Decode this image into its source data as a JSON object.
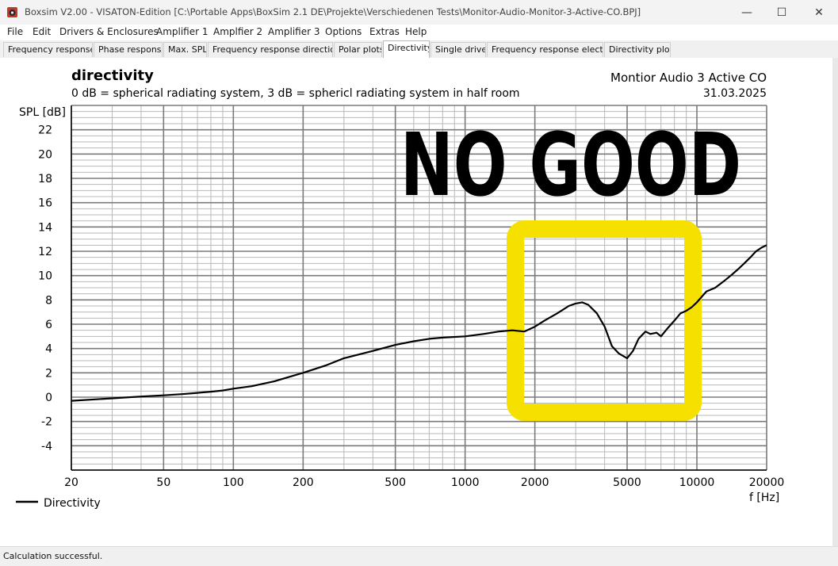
{
  "window": {
    "title": "Boxsim V2.00 - VISATON-Edition [C:\\Portable Apps\\BoxSim 2.1 DE\\Projekte\\Verschiedenen Tests\\Monitor-Audio-Monitor-3-Active-CO.BPJ]",
    "minimize_glyph": "—",
    "maximize_glyph": "☐",
    "close_glyph": "✕"
  },
  "menu": [
    "File",
    "Edit",
    "Drivers & Enclosures",
    "Amplifier 1",
    "Amplfier 2",
    "Amplifier 3",
    "Options",
    "Extras",
    "Help"
  ],
  "tabs": [
    {
      "label": "Frequency response.",
      "active": false
    },
    {
      "label": "Phase response",
      "active": false
    },
    {
      "label": "Max. SPL",
      "active": false
    },
    {
      "label": "Frequency response directions",
      "active": false
    },
    {
      "label": "Polar plots",
      "active": false
    },
    {
      "label": "Directivity",
      "active": true
    },
    {
      "label": "Single driver",
      "active": false
    },
    {
      "label": "Frequency response electr..",
      "active": false
    },
    {
      "label": "Directivity plots",
      "active": false
    }
  ],
  "status": "Calculation successful.",
  "colors": {
    "curve": "#000000",
    "highlight": "#f5e000",
    "grid_major": "#7a7a7a",
    "grid_minor": "#b8b8b8"
  },
  "chart_data": {
    "type": "line",
    "title": "directivity",
    "subtitle": "0 dB = spherical radiating system, 3 dB = sphericl radiating system in half room",
    "project": "Montior Audio 3 Active CO",
    "date": "31.03.2025",
    "ylabel": "SPL [dB]",
    "xlabel": "f [Hz]",
    "xscale": "log",
    "xlim": [
      20,
      20000
    ],
    "ylim": [
      -6,
      24
    ],
    "x_ticks": [
      20,
      50,
      100,
      200,
      500,
      1000,
      2000,
      5000,
      10000,
      20000
    ],
    "y_ticks": [
      -4,
      -2,
      0,
      2,
      4,
      6,
      8,
      10,
      12,
      14,
      16,
      18,
      20,
      22
    ],
    "legend_position": "bottom-left",
    "annotation_text": "NO GOOD",
    "series": [
      {
        "name": "Directivity",
        "x": [
          20,
          30,
          40,
          50,
          60,
          70,
          80,
          90,
          100,
          120,
          150,
          200,
          250,
          300,
          400,
          500,
          600,
          700,
          800,
          1000,
          1200,
          1400,
          1600,
          1800,
          2000,
          2200,
          2500,
          2800,
          3000,
          3200,
          3400,
          3700,
          4000,
          4300,
          4600,
          5000,
          5300,
          5600,
          6000,
          6300,
          6700,
          7000,
          7500,
          8000,
          8500,
          9000,
          9500,
          10000,
          11000,
          12000,
          13000,
          14000,
          15000,
          16000,
          17000,
          18000,
          19000,
          20000
        ],
        "y": [
          -0.3,
          -0.1,
          0.05,
          0.15,
          0.25,
          0.35,
          0.45,
          0.55,
          0.7,
          0.9,
          1.3,
          2.0,
          2.6,
          3.2,
          3.8,
          4.3,
          4.6,
          4.8,
          4.9,
          5.0,
          5.2,
          5.4,
          5.5,
          5.4,
          5.8,
          6.3,
          6.9,
          7.5,
          7.7,
          7.8,
          7.6,
          6.9,
          5.8,
          4.2,
          3.6,
          3.2,
          3.8,
          4.8,
          5.4,
          5.2,
          5.3,
          5.0,
          5.7,
          6.3,
          6.9,
          7.1,
          7.4,
          7.8,
          8.7,
          9.0,
          9.5,
          10.0,
          10.5,
          11.0,
          11.5,
          12.0,
          12.3,
          12.5
        ]
      }
    ]
  }
}
